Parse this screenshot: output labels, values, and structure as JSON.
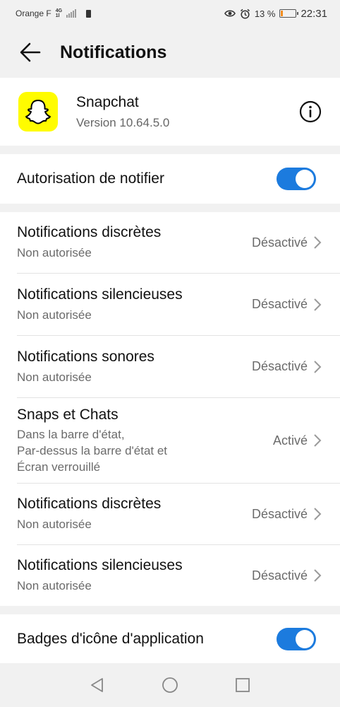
{
  "status_bar": {
    "carrier": "Orange F",
    "network_top": "4G",
    "network_bottom": "1l",
    "battery_percent": "13 %",
    "battery_level": 0.13,
    "time": "22:31",
    "icons": [
      "signal-icon",
      "sim-icon",
      "eye-icon",
      "alarm-icon",
      "battery-icon"
    ]
  },
  "header": {
    "title": "Notifications"
  },
  "app": {
    "name": "Snapchat",
    "version": "Version 10.64.5.0",
    "icon_color": "#fffc00"
  },
  "allow_notifications": {
    "label": "Autorisation de notifier",
    "enabled": true
  },
  "categories": [
    {
      "title": "Notifications discrètes",
      "subtitle": "Non autorisée",
      "value": "Désactivé"
    },
    {
      "title": "Notifications silencieuses",
      "subtitle": "Non autorisée",
      "value": "Désactivé"
    },
    {
      "title": "Notifications sonores",
      "subtitle": "Non autorisée",
      "value": "Désactivé"
    },
    {
      "title": "Snaps et Chats",
      "subtitle_lines": [
        "Dans la barre d'état,",
        "Par-dessus la barre d'état et",
        "Écran verrouillé"
      ],
      "value": "Activé"
    },
    {
      "title": "Notifications discrètes",
      "subtitle": "Non autorisée",
      "value": "Désactivé"
    },
    {
      "title": "Notifications silencieuses",
      "subtitle": "Non autorisée",
      "value": "Désactivé"
    }
  ],
  "badges": {
    "label": "Badges d'icône d'application",
    "enabled": true
  },
  "colors": {
    "accent": "#1c7bde",
    "background": "#f1f1f1",
    "card": "#ffffff",
    "battery_low": "#f28c1c"
  }
}
